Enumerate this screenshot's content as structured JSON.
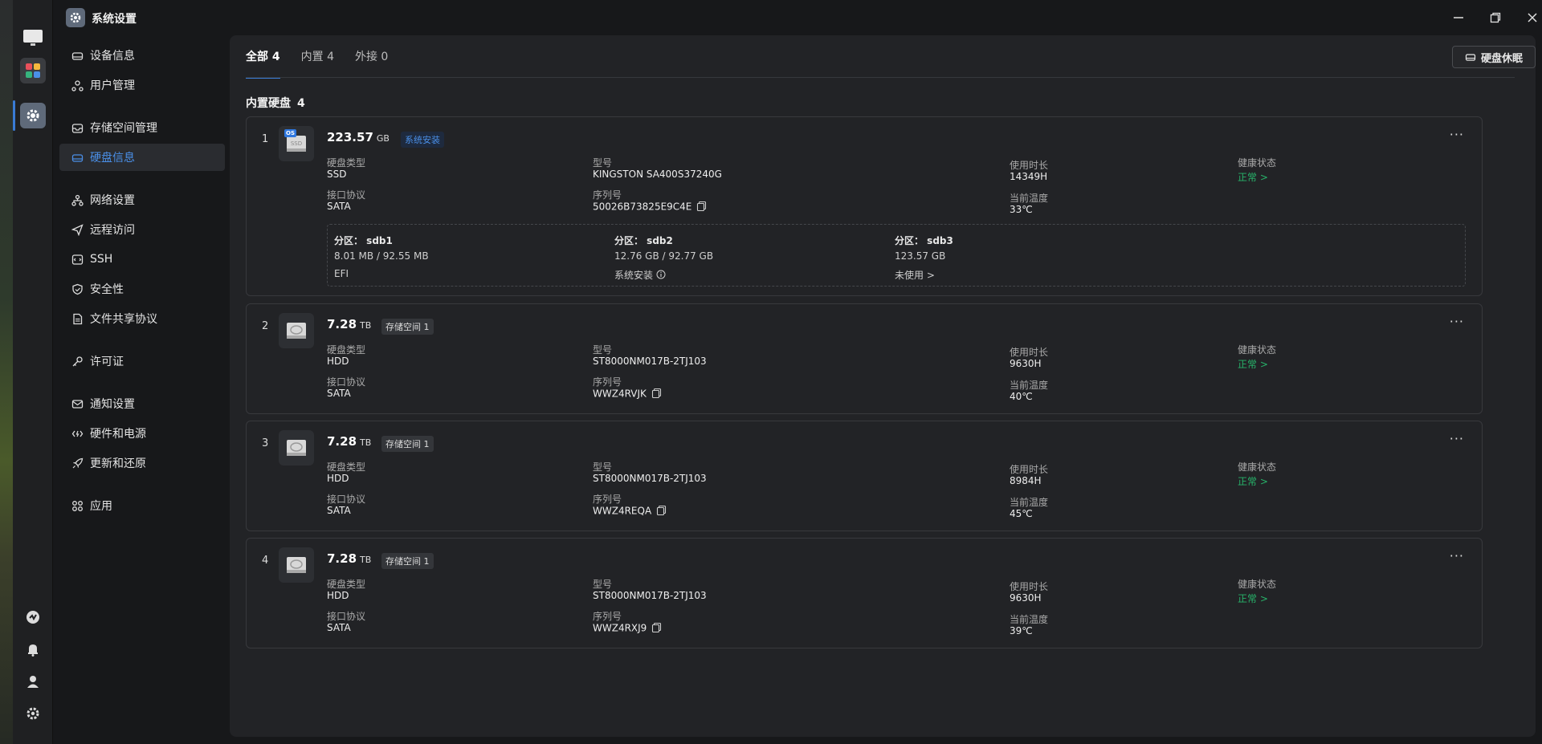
{
  "window": {
    "title": "系统设置"
  },
  "sidebar": {
    "items": [
      {
        "label": "设备信息",
        "icon": "device-icon"
      },
      {
        "label": "用户管理",
        "icon": "users-icon"
      },
      {
        "label": "存储空间管理",
        "icon": "storage-icon"
      },
      {
        "label": "硬盘信息",
        "icon": "disk-icon",
        "active": true
      },
      {
        "label": "网络设置",
        "icon": "network-icon"
      },
      {
        "label": "远程访问",
        "icon": "send-icon"
      },
      {
        "label": "SSH",
        "icon": "terminal-icon"
      },
      {
        "label": "安全性",
        "icon": "shield-icon"
      },
      {
        "label": "文件共享协议",
        "icon": "file-icon"
      },
      {
        "label": "许可证",
        "icon": "key-icon"
      },
      {
        "label": "通知设置",
        "icon": "mail-icon"
      },
      {
        "label": "硬件和电源",
        "icon": "power-icon"
      },
      {
        "label": "更新和还原",
        "icon": "rocket-icon"
      },
      {
        "label": "应用",
        "icon": "apps-icon"
      }
    ]
  },
  "tabs": [
    {
      "label": "全部 4",
      "active": true
    },
    {
      "label": "内置 4"
    },
    {
      "label": "外接 0"
    }
  ],
  "toolbar": {
    "sleep_label": "硬盘休眠"
  },
  "section": {
    "title": "内置硬盘",
    "count": "4"
  },
  "field_labels": {
    "type": "硬盘类型",
    "protocol": "接口协议",
    "model": "型号",
    "serial": "序列号",
    "hours": "使用时长",
    "temp": "当前温度",
    "health": "健康状态"
  },
  "disks": [
    {
      "index": "1",
      "capacity": "223.57",
      "unit": "GB",
      "badge": "系统安装",
      "icon_label": "SSD",
      "os_tag": "OS",
      "type": "SSD",
      "protocol": "SATA",
      "model": "KINGSTON SA400S37240G",
      "serial": "50026B73825E9C4E",
      "hours": "14349H",
      "temp": "33℃",
      "health": "正常 >",
      "partitions": [
        {
          "name": "分区：  sdb1",
          "size": "8.01 MB / 92.55 MB",
          "usage": "EFI"
        },
        {
          "name": "分区：  sdb2",
          "size": "12.76 GB / 92.77 GB",
          "usage": "系统安装"
        },
        {
          "name": "分区：  sdb3",
          "size": "123.57 GB",
          "usage": "未使用 >"
        }
      ]
    },
    {
      "index": "2",
      "capacity": "7.28",
      "unit": "TB",
      "badge": "存储空间 1",
      "type": "HDD",
      "protocol": "SATA",
      "model": "ST8000NM017B-2TJ103",
      "serial": "WWZ4RVJK",
      "hours": "9630H",
      "temp": "40℃",
      "health": "正常 >"
    },
    {
      "index": "3",
      "capacity": "7.28",
      "unit": "TB",
      "badge": "存储空间 1",
      "type": "HDD",
      "protocol": "SATA",
      "model": "ST8000NM017B-2TJ103",
      "serial": "WWZ4REQA",
      "hours": "8984H",
      "temp": "45℃",
      "health": "正常 >"
    },
    {
      "index": "4",
      "capacity": "7.28",
      "unit": "TB",
      "badge": "存储空间 1",
      "type": "HDD",
      "protocol": "SATA",
      "model": "ST8000NM017B-2TJ103",
      "serial": "WWZ4RXJ9",
      "hours": "9630H",
      "temp": "39℃",
      "health": "正常 >"
    }
  ],
  "colors": {
    "accent": "#3a7bd5",
    "health_ok": "#27b36a",
    "background": "#17181a"
  }
}
